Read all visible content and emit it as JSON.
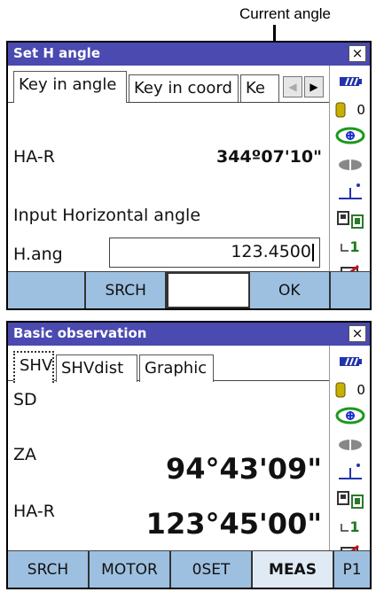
{
  "annotation": {
    "callout": "Current angle"
  },
  "window1": {
    "title": "Set H angle",
    "close": "×",
    "tabs": [
      "Key in angle",
      "Key in coord",
      "Ke"
    ],
    "ha_label": "HA-R",
    "ha_value": "344º07'10\"",
    "prompt": "Input Horizontal angle",
    "hang_label": "H.ang",
    "hang_value": "123.4500",
    "softkeys": [
      "SRCH",
      "",
      "OK"
    ]
  },
  "window2": {
    "title": "Basic observation",
    "close": "×",
    "tabs": [
      "SHV",
      "SHVdist",
      "Graphic"
    ],
    "sd_label": "SD",
    "za_label": "ZA",
    "za_value": "94°43'09\"",
    "ha_label": "HA-R",
    "ha_value": "123°45'00\"",
    "softkeys": [
      "SRCH",
      "MOTOR",
      "0SET",
      "MEAS",
      "P1"
    ]
  },
  "status": {
    "prism_constant": "0",
    "channel": "1"
  },
  "colors": {
    "titlebar": "#4a4ab0",
    "softkeys": "#9ec0e0",
    "battery": "#2233aa"
  }
}
